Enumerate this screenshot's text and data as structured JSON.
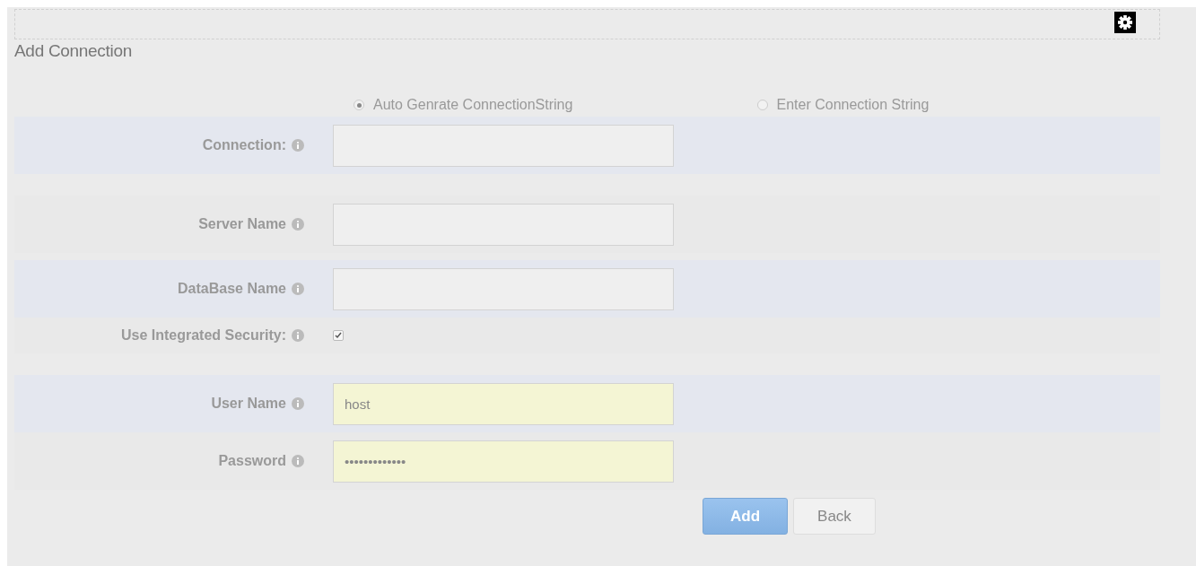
{
  "title": "Add Connection",
  "mode_options": [
    {
      "label": "Auto Genrate ConnectionString",
      "selected": true
    },
    {
      "label": "Enter Connection String",
      "selected": false
    }
  ],
  "fields": [
    {
      "kind": "text",
      "label": "Connection:",
      "autofilled": false
    },
    {
      "kind": "text",
      "label": "Server Name",
      "autofilled": false
    },
    {
      "kind": "text",
      "label": "DataBase Name",
      "autofilled": false
    },
    {
      "kind": "checkbox",
      "label": "Use Integrated Security:",
      "checked": true
    },
    {
      "kind": "text",
      "label": "User Name",
      "value": "host",
      "autofilled": true
    },
    {
      "kind": "text",
      "label": "Password",
      "value": "•••••••••••••",
      "autofilled": true
    }
  ],
  "buttons": [
    {
      "label": "Add",
      "kind": "primary"
    },
    {
      "label": "Back",
      "kind": "default"
    }
  ]
}
